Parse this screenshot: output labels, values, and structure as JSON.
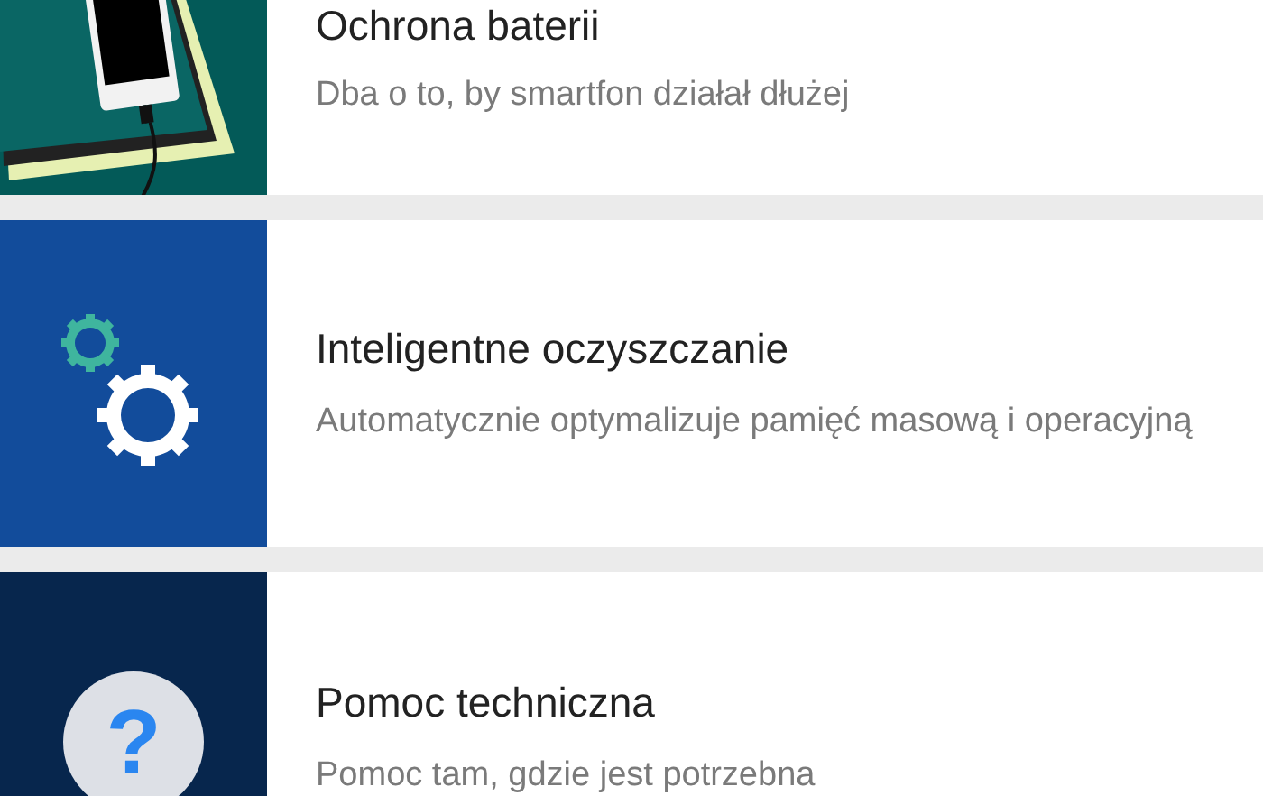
{
  "cards": [
    {
      "kind": "battery",
      "title": "Ochrona baterii",
      "subtitle": "Dba o to, by smartfon działał dłużej"
    },
    {
      "kind": "cleanup",
      "title": "Inteligentne oczyszczanie",
      "subtitle": "Automatycznie optymalizuje pamięć masową i operacyjną"
    },
    {
      "kind": "support",
      "title": "Pomoc techniczna",
      "subtitle": "Pomoc tam, gdzie jest potrzebna",
      "glyph": "?"
    }
  ]
}
